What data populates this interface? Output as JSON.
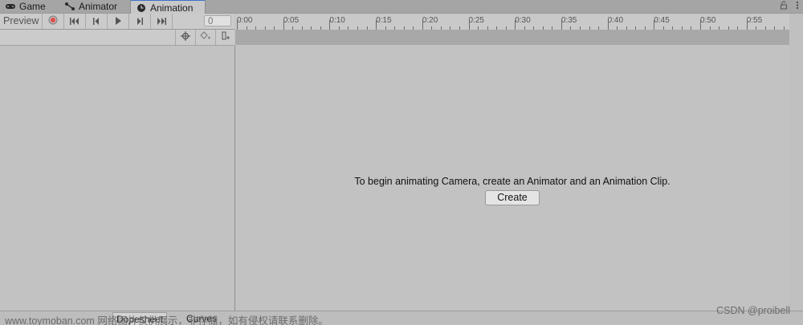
{
  "tabs": [
    {
      "label": "Game",
      "icon": "gamepad-icon"
    },
    {
      "label": "Animator",
      "icon": "animator-graph-icon"
    },
    {
      "label": "Animation",
      "icon": "animation-clock-icon",
      "active": true
    }
  ],
  "toolbar": {
    "preview_label": "Preview",
    "frame_value": "0"
  },
  "ruler": {
    "ticks": [
      "0:00",
      "0:05",
      "0:10",
      "0:15",
      "0:20",
      "0:25",
      "0:30",
      "0:35",
      "0:40",
      "0:45",
      "0:50",
      "0:55"
    ]
  },
  "main": {
    "message": "To begin animating Camera, create an Animator and an Animation Clip.",
    "create_label": "Create"
  },
  "bottom": {
    "dopesheet_label": "Dopesheet",
    "curves_label": "Curves"
  },
  "watermark": {
    "left": "www.toymoban.com 网络图片仅供展示，非存储，如有侵权请联系删除。",
    "right": "CSDN @proibell"
  },
  "colors": {
    "tab_accent": "#3a72c9",
    "record": "#d9534f"
  }
}
